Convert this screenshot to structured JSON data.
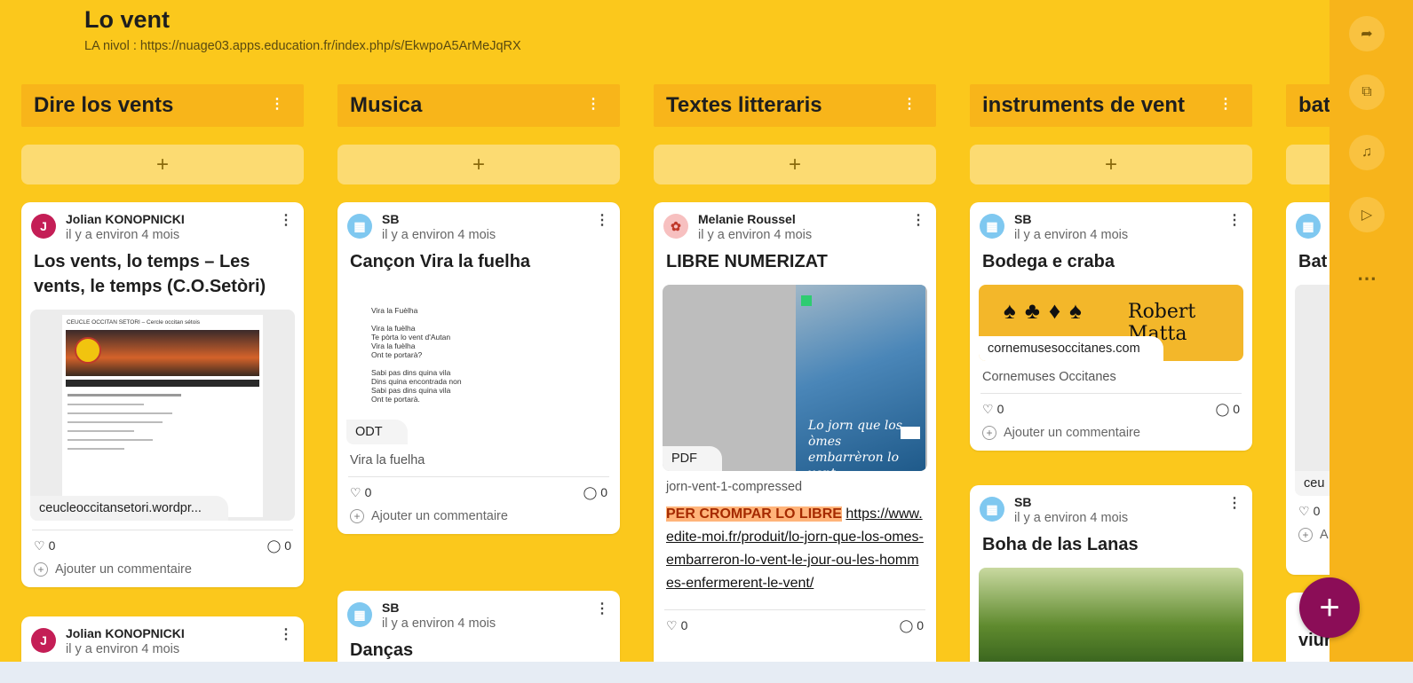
{
  "board": {
    "title": "Lo vent",
    "subtitle": "LA nivol : https://nuage03.apps.education.fr/index.php/s/EkwpoA5ArMeJqRX"
  },
  "columns": [
    {
      "title": "Dire los vents",
      "cards": [
        {
          "author": "Jolian KONOPNICKI",
          "avatar": "J",
          "time": "il y a environ 4 mois",
          "title": "Los vents, lo temps – Les vents, le temps (C.O.Setòri)",
          "site_header": "CEUCLE OCCITAN SETORI – Cercle occitan sétois",
          "tag": "ceucleoccitansetori.wordpr...",
          "likes": "0",
          "comments": "0",
          "add_comment": "Ajouter un commentaire"
        },
        {
          "author": "Jolian KONOPNICKI",
          "avatar": "J",
          "time": "il y a environ 4 mois"
        }
      ]
    },
    {
      "title": "Musica",
      "cards": [
        {
          "author": "SB",
          "time": "il y a environ 4 mois",
          "title": "Cançon Vira la fuelha",
          "doc_lines": [
            "Vira la Fuèlha",
            "",
            "Vira la fuèlha",
            "Te pòrta lo vent d'Autan",
            "Vira la fuèlha",
            "Ont te portarà?",
            "",
            "Sabi pas dins quina vila",
            "Dins quina encontrada non",
            "Sabi pas dins quina vila",
            "Ont te portarà."
          ],
          "tag": "ODT",
          "caption": "Vira la fuelha",
          "likes": "0",
          "comments": "0",
          "add_comment": "Ajouter un commentaire"
        },
        {
          "author": "SB",
          "time": "il y a environ 4 mois",
          "title": "Danças"
        }
      ]
    },
    {
      "title": "Textes litteraris",
      "cards": [
        {
          "author": "Melanie Roussel",
          "time": "il y a environ 4 mois",
          "title": "LIBRE NUMERIZAT",
          "book_title": "Lo jorn que los òmes embarrèron lo vent",
          "tag": "PDF",
          "caption": "jorn-vent-1-compressed",
          "highlight": "PER CROMPAR LO LIBRE",
          "link": "https://www.edite-moi.fr/produit/lo-jorn-que-los-omes-embarreron-lo-vent-le-jour-ou-les-hommes-enfermerent-le-vent/",
          "likes": "0",
          "comments": "0"
        }
      ]
    },
    {
      "title": "instruments de vent",
      "cards": [
        {
          "author": "SB",
          "time": "il y a environ 4 mois",
          "title": "Bodega e craba",
          "brand": "Robert Matta",
          "tag": "cornemusesoccitanes.com",
          "caption": "Cornemuses Occitanes",
          "likes": "0",
          "comments": "0",
          "add_comment": "Ajouter un commentaire"
        },
        {
          "author": "SB",
          "time": "il y a environ 4 mois",
          "title": "Boha de las Lanas"
        }
      ]
    },
    {
      "title": "bat",
      "cards": [
        {
          "title": "Bat",
          "tag": "ceu",
          "likes": "0",
          "add_comment": "A"
        },
        {
          "title": "viur"
        }
      ]
    }
  ],
  "rail": {
    "icons": [
      "share-icon",
      "crop-icon",
      "bell-icon",
      "play-icon",
      "more-icon"
    ]
  },
  "colors": {
    "background": "#fbc81c",
    "column_header": "#f8b51a",
    "fab": "#8b0d57",
    "avatar_j": "#c41e56",
    "avatar_sb": "#7fc8f0"
  }
}
